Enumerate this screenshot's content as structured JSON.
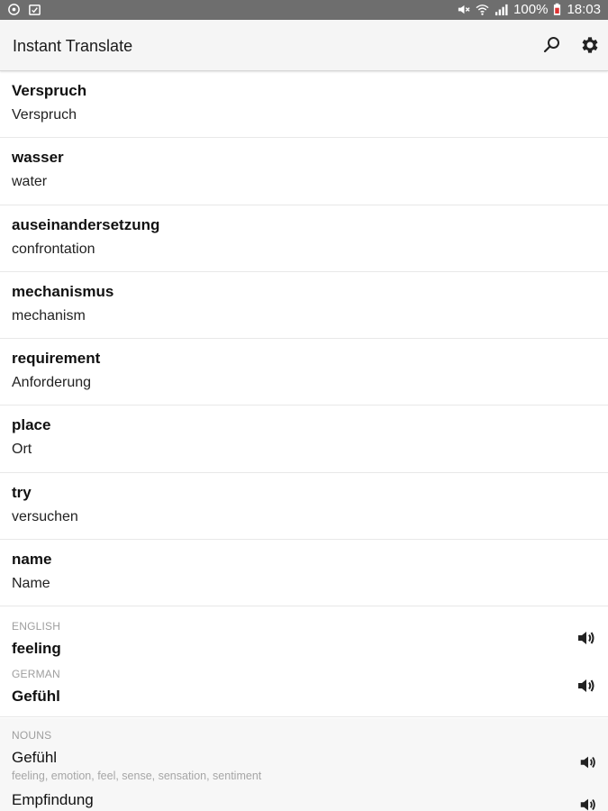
{
  "status_bar": {
    "battery": "100%",
    "time": "18:03",
    "icons": [
      "sync-icon",
      "notification-icon",
      "mute-icon",
      "wifi-icon",
      "signal-icon",
      "battery-icon"
    ]
  },
  "app_bar": {
    "title": "Instant Translate",
    "icons": [
      "search-icon",
      "settings-icon"
    ]
  },
  "history": [
    {
      "word": "Verspruch",
      "translation": "Verspruch"
    },
    {
      "word": "wasser",
      "translation": "water"
    },
    {
      "word": "auseinandersetzung",
      "translation": "confrontation"
    },
    {
      "word": "mechanismus",
      "translation": "mechanism"
    },
    {
      "word": "requirement",
      "translation": "Anforderung"
    },
    {
      "word": "place",
      "translation": "Ort"
    },
    {
      "word": "try",
      "translation": "versuchen"
    },
    {
      "word": "name",
      "translation": "Name"
    }
  ],
  "detail": {
    "source_lang": "ENGLISH",
    "source_word": "feeling",
    "target_lang": "GERMAN",
    "target_word": "Gefühl"
  },
  "nouns": {
    "header": "NOUNS",
    "entries": [
      {
        "word": "Gefühl",
        "synonyms": "feeling, emotion, feel, sense, sensation, sentiment"
      },
      {
        "word": "Empfindung",
        "synonyms": ""
      }
    ]
  },
  "colors": {
    "status_bar": "#6e6e6e",
    "app_bar": "#f5f5f5",
    "label_gray": "#9e9e9e"
  }
}
